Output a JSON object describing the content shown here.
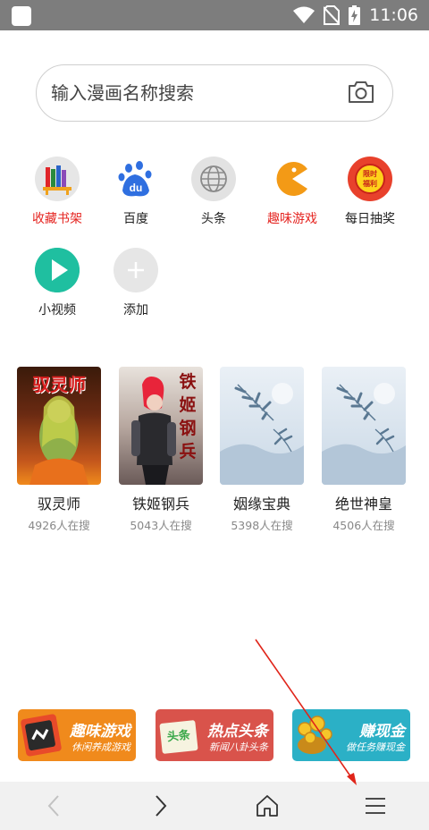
{
  "status_bar": {
    "time": "11:06"
  },
  "search": {
    "placeholder": "输入漫画名称搜索"
  },
  "shortcuts": [
    {
      "label": "收藏书架",
      "icon": "bookshelf-icon",
      "highlight": true
    },
    {
      "label": "百度",
      "icon": "baidu-paw-icon",
      "highlight": false
    },
    {
      "label": "头条",
      "icon": "globe-icon",
      "highlight": false
    },
    {
      "label": "趣味游戏",
      "icon": "pacman-icon",
      "highlight": true
    },
    {
      "label": "每日抽奖",
      "icon": "lottery-icon",
      "highlight": false,
      "badge": "限时福利"
    },
    {
      "label": "小视频",
      "icon": "play-icon",
      "highlight": false
    },
    {
      "label": "添加",
      "icon": "plus-icon",
      "highlight": false
    }
  ],
  "comics": [
    {
      "title": "驭灵师",
      "count": "4926人在搜",
      "cover_text": "驭灵师"
    },
    {
      "title": "铁姬钢兵",
      "count": "5043人在搜",
      "cover_text": "铁姬钢兵"
    },
    {
      "title": "姻缘宝典",
      "count": "5398人在搜"
    },
    {
      "title": "绝世神皇",
      "count": "4506人在搜"
    }
  ],
  "banners": [
    {
      "title": "趣味游戏",
      "subtitle": "休闲养成游戏",
      "color": "#f08a1c"
    },
    {
      "title": "热点头条",
      "subtitle": "新闻八卦头条",
      "color": "#d9534b",
      "tag": "头条"
    },
    {
      "title": "赚现金",
      "subtitle": "做任务赚现金",
      "color": "#2bb0c6"
    }
  ],
  "bottom_nav": [
    "back-icon",
    "forward-icon",
    "home-icon",
    "menu-icon"
  ],
  "colors": {
    "accent_red": "#e52420",
    "status_bar": "#7d7d7d",
    "nav_bg": "#f1f1f1"
  }
}
